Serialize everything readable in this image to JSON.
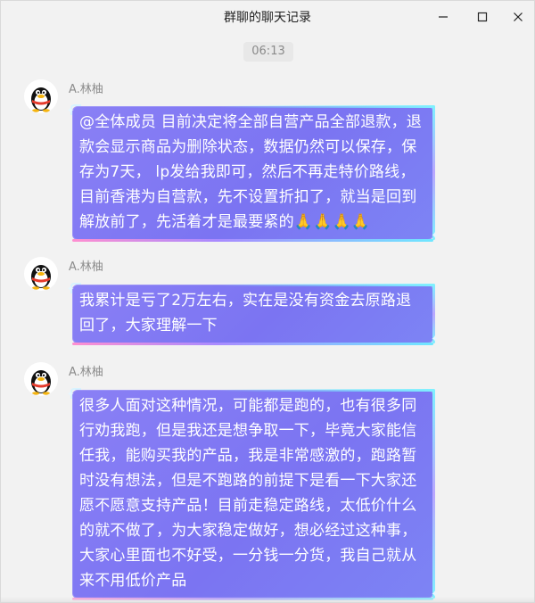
{
  "window": {
    "title": "群聊的聊天记录",
    "controls": [
      "minimize-icon",
      "maximize-icon",
      "close-icon"
    ]
  },
  "timestamp": "06:13",
  "messages": [
    {
      "sender": "A.林柚",
      "avatar_icon": "qq-penguin-avatar",
      "text": "@全体成员 目前决定将全部自营产品全部退款，退款会显示商品为删除状态，数据仍然可以保存，保存为7天， lp发给我即可，然后不再走特价路线，目前香港为自营款，先不设置折扣了，就当是回到解放前了，先活着才是最要紧的🙏🙏🙏🙏"
    },
    {
      "sender": "A.林柚",
      "avatar_icon": "qq-penguin-avatar",
      "text": "我累计是亏了2万左右，实在是没有资金去原路退回了，大家理解一下"
    },
    {
      "sender": "A.林柚",
      "avatar_icon": "qq-penguin-avatar",
      "text": "很多人面对这种情况，可能都是跑的，也有很多同行劝我跑，但是我还是想争取一下，毕竟大家能信任我，能购买我的产品，我是非常感激的，跑路暂时没有想法，但是不跑路的前提下是看一下大家还愿不愿意支持产品！目前走稳定路线，太低价什么的就不做了，为大家稳定做好，想必经过这种事，大家心里面也不好受，一分钱一分货，我自己就从来不用低价产品"
    }
  ],
  "colors": {
    "background": "#f2f2f2",
    "bubble": "#7b74f2",
    "bubble_text": "#ffffff",
    "sender": "#8c8c8c"
  }
}
